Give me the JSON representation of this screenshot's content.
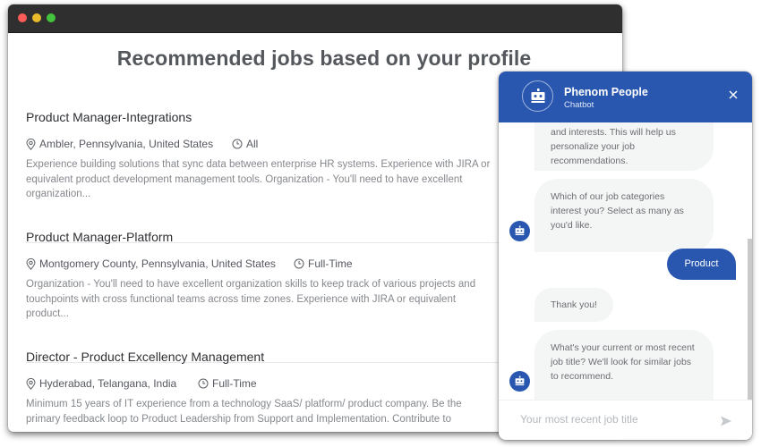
{
  "window": {
    "controls": [
      "close",
      "minimize",
      "maximize"
    ]
  },
  "page": {
    "title": "Recommended jobs based on your profile",
    "jobs": [
      {
        "title": "Product Manager-Integrations",
        "location": "Ambler, Pennsylvania, United States",
        "type": "All",
        "description": "Experience building solutions that sync data between enterprise HR systems. Experience with JIRA or equivalent product development management tools. Organization - You'll need to have excellent organization..."
      },
      {
        "title": "Product Manager-Platform",
        "location": "Montgomery County, Pennsylvania, United States",
        "type": "Full-Time",
        "description": "Organization - You'll need to have excellent organization skills to keep track of various projects and touchpoints with cross functional teams across time zones. Experience with JIRA or equivalent product..."
      },
      {
        "title": "Director - Product Excellency Management",
        "location": "Hyderabad, Telangana, India",
        "type": "Full-Time",
        "description": "Minimum 15 years of IT experience from a technology SaaS/ platform/ product company. Be the primary feedback loop to Product Leadership from Support and Implementation. Contribute to"
      }
    ]
  },
  "chatbot": {
    "name": "Phenom People",
    "subtitle": "Chatbot",
    "icons": {
      "avatar": "robot-icon",
      "close": "close-icon",
      "send": "send-icon"
    },
    "colors": {
      "brand": "#2957b0",
      "bot_bubble": "#f4f5f5"
    },
    "messages": [
      {
        "from": "bot",
        "text": "and interests. This will help us personalize your job recommendations."
      },
      {
        "from": "bot",
        "text": "Which of our job categories interest you? Select as many as you'd like."
      },
      {
        "from": "user",
        "text": "Product"
      },
      {
        "from": "bot",
        "text": "Thank you!"
      },
      {
        "from": "bot",
        "text": "What's your current or most recent job title? We'll look for similar jobs to recommend."
      }
    ],
    "input": {
      "value": "",
      "placeholder": "Your most recent job title"
    }
  }
}
